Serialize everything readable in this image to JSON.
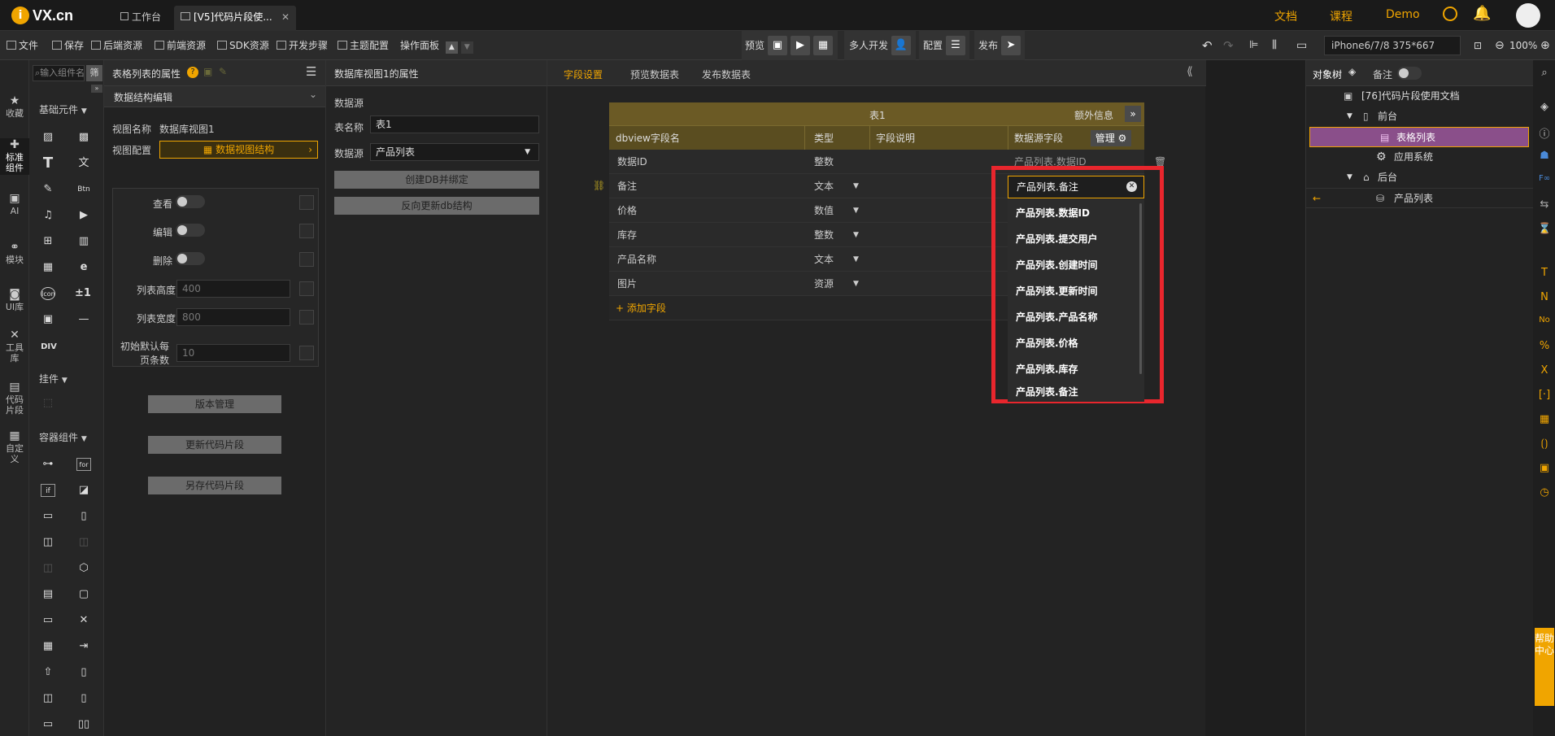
{
  "topbar": {
    "logo": "VX.cn",
    "tabs": [
      {
        "label": "工作台"
      },
      {
        "label": "[V5]代码片段使..."
      }
    ],
    "links": [
      {
        "label": "文档"
      },
      {
        "label": "课程"
      },
      {
        "label": "Demo"
      }
    ]
  },
  "toolbar": {
    "items": [
      {
        "label": "文件"
      },
      {
        "label": "保存"
      },
      {
        "label": "后端资源"
      },
      {
        "label": "前端资源"
      },
      {
        "label": "SDK资源"
      },
      {
        "label": "开发步骤"
      },
      {
        "label": "主题配置"
      },
      {
        "label": "操作面板"
      }
    ],
    "preview": "预览",
    "multi_dev": "多人开发",
    "config": "配置",
    "publish": "发布",
    "device": "iPhone6/7/8 375*667",
    "zoom": "100%"
  },
  "rail": {
    "items": [
      {
        "label": "收藏"
      },
      {
        "label": "标准组件"
      },
      {
        "label": "AI"
      },
      {
        "label": "模块"
      },
      {
        "label": "UI库"
      },
      {
        "label": "工具库"
      },
      {
        "label": "代码片段"
      },
      {
        "label": "自定义"
      }
    ]
  },
  "palette": {
    "search_placeholder": "输入组件名称",
    "filter": "筛",
    "section_basic": "基础元件",
    "section_plugins": "挂件",
    "section_container": "容器组件",
    "div_label": "DIV"
  },
  "props": {
    "title": "表格列表的属性",
    "section": "数据结构编辑",
    "view_name_label": "视图名称",
    "view_name_value": "数据库视图1",
    "view_config_label": "视图配置",
    "view_config_button": "数据视图结构",
    "toggles": [
      {
        "label": "查看"
      },
      {
        "label": "编辑"
      },
      {
        "label": "删除"
      }
    ],
    "fields": [
      {
        "label": "列表高度",
        "value": "400"
      },
      {
        "label": "列表宽度",
        "value": "800"
      },
      {
        "label": "初始默认每页条数",
        "value": "10"
      }
    ],
    "buttons": [
      {
        "label": "版本管理"
      },
      {
        "label": "更新代码片段"
      },
      {
        "label": "另存代码片段"
      }
    ]
  },
  "dbprops": {
    "title": "数据库视图1的属性",
    "source_heading": "数据源",
    "table_name_label": "表名称",
    "table_name_value": "表1",
    "source_label": "数据源",
    "source_value": "产品列表",
    "buttons": [
      {
        "label": "创建DB并绑定"
      },
      {
        "label": "反向更新db结构"
      }
    ]
  },
  "main": {
    "tabs": [
      {
        "label": "字段设置"
      },
      {
        "label": "预览数据表"
      },
      {
        "label": "发布数据表"
      }
    ],
    "table_title": "表1",
    "extra_info": "额外信息",
    "headers": {
      "name": "dbview字段名",
      "type": "类型",
      "desc": "字段说明",
      "source": "数据源字段",
      "manage": "管理"
    },
    "rows": [
      {
        "name": "数据ID",
        "type": "整数",
        "source": "产品列表.数据ID"
      },
      {
        "name": "备注",
        "type": "文本",
        "source": "产品列表.备注"
      },
      {
        "name": "价格",
        "type": "数值",
        "source": ""
      },
      {
        "name": "库存",
        "type": "整数",
        "source": ""
      },
      {
        "name": "产品名称",
        "type": "文本",
        "source": ""
      },
      {
        "name": "图片",
        "type": "资源",
        "source": ""
      }
    ],
    "add_field": "+ 添加字段",
    "dropdown_options": [
      {
        "label": "产品列表.数据ID"
      },
      {
        "label": "产品列表.提交用户"
      },
      {
        "label": "产品列表.创建时间"
      },
      {
        "label": "产品列表.更新时间"
      },
      {
        "label": "产品列表.产品名称"
      },
      {
        "label": "产品列表.价格"
      },
      {
        "label": "产品列表.库存"
      },
      {
        "label": "产品列表.备注"
      }
    ]
  },
  "tree": {
    "tab_objects": "对象树",
    "tab_notes": "备注",
    "nodes": [
      {
        "label": "[76]代码片段使用文档"
      },
      {
        "label": "前台"
      },
      {
        "label": "表格列表"
      },
      {
        "label": "应用系统"
      },
      {
        "label": "后台"
      },
      {
        "label": "产品列表"
      }
    ]
  },
  "help": {
    "label": "帮助中心"
  },
  "colors": {
    "accent": "#f0a500",
    "highlight_red": "#e8262d",
    "table_header": "#6b5a25",
    "selected_node": "#8a4f8a"
  }
}
